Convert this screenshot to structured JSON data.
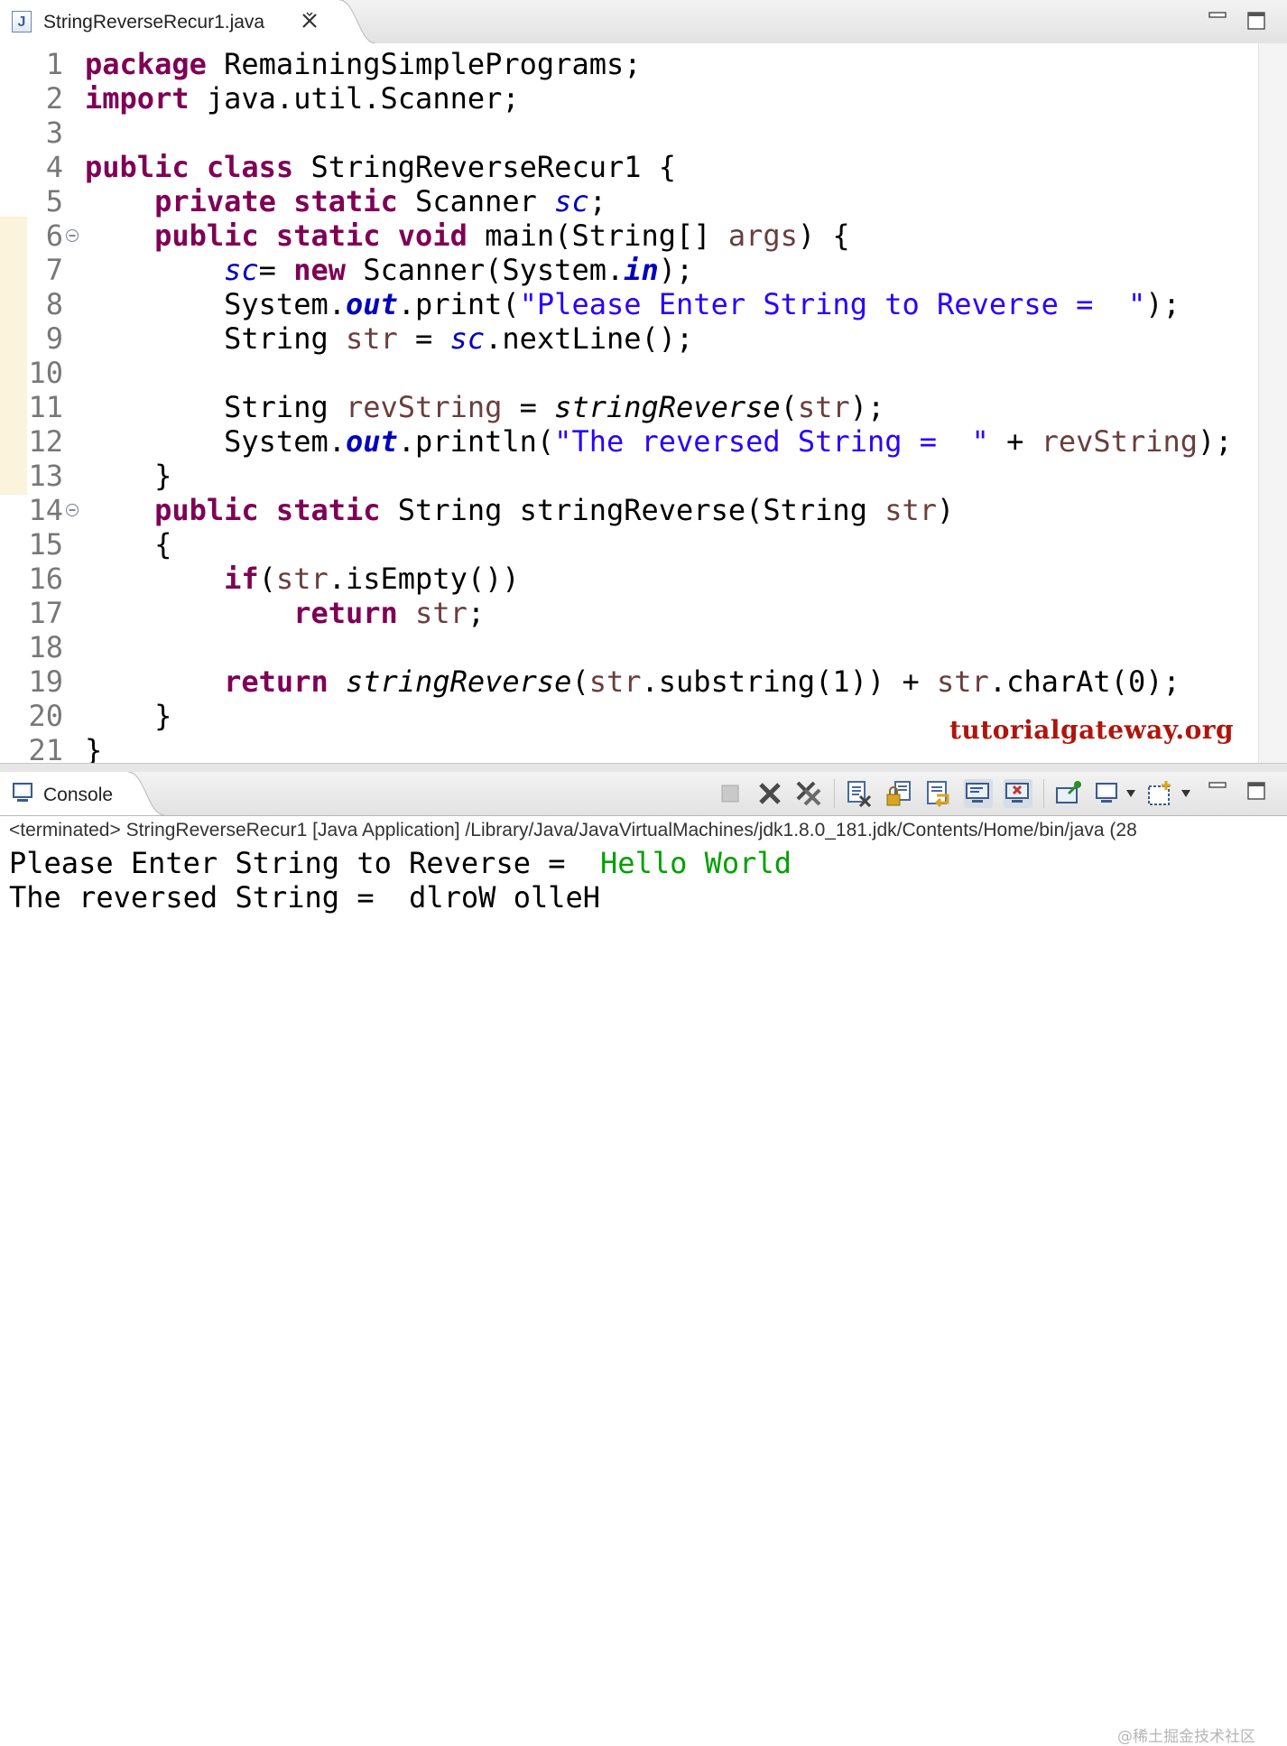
{
  "editor_tab": {
    "title": "StringReverseRecur1.java",
    "icon": "java-file-icon",
    "icon_letter": "J"
  },
  "code": {
    "line_numbers": [
      "1",
      "2",
      "3",
      "4",
      "5",
      "6",
      "7",
      "8",
      "9",
      "10",
      "11",
      "12",
      "13",
      "14",
      "15",
      "16",
      "17",
      "18",
      "19",
      "20",
      "21"
    ],
    "folded_lines": [
      "6",
      "14"
    ],
    "lines": [
      [
        {
          "t": "package",
          "k": "kw"
        },
        {
          "t": " RemainingSimplePrograms;"
        }
      ],
      [
        {
          "t": "import",
          "k": "kw"
        },
        {
          "t": " java.util.Scanner;"
        }
      ],
      [],
      [
        {
          "t": "public",
          "k": "kw"
        },
        {
          "t": " "
        },
        {
          "t": "class",
          "k": "kw"
        },
        {
          "t": " StringReverseRecur1 {"
        }
      ],
      [
        {
          "t": "    "
        },
        {
          "t": "private",
          "k": "kw"
        },
        {
          "t": " "
        },
        {
          "t": "static",
          "k": "kw"
        },
        {
          "t": " Scanner "
        },
        {
          "t": "sc",
          "k": "fld"
        },
        {
          "t": ";"
        }
      ],
      [
        {
          "t": "    "
        },
        {
          "t": "public",
          "k": "kw"
        },
        {
          "t": " "
        },
        {
          "t": "static",
          "k": "kw"
        },
        {
          "t": " "
        },
        {
          "t": "void",
          "k": "kw"
        },
        {
          "t": " main(String[] "
        },
        {
          "t": "args",
          "k": "var"
        },
        {
          "t": ") {"
        }
      ],
      [
        {
          "t": "        "
        },
        {
          "t": "sc",
          "k": "fld"
        },
        {
          "t": "= "
        },
        {
          "t": "new",
          "k": "kw"
        },
        {
          "t": " Scanner(System."
        },
        {
          "t": "in",
          "k": "sfld"
        },
        {
          "t": ");"
        }
      ],
      [
        {
          "t": "        System."
        },
        {
          "t": "out",
          "k": "sfld"
        },
        {
          "t": ".print("
        },
        {
          "t": "\"Please Enter String to Reverse =  \"",
          "k": "str"
        },
        {
          "t": ");"
        }
      ],
      [
        {
          "t": "        String "
        },
        {
          "t": "str",
          "k": "var"
        },
        {
          "t": " = "
        },
        {
          "t": "sc",
          "k": "fld"
        },
        {
          "t": ".nextLine();"
        }
      ],
      [],
      [
        {
          "t": "        String "
        },
        {
          "t": "revString",
          "k": "var"
        },
        {
          "t": " = "
        },
        {
          "t": "stringReverse",
          "k": "mi"
        },
        {
          "t": "("
        },
        {
          "t": "str",
          "k": "var"
        },
        {
          "t": ");"
        }
      ],
      [
        {
          "t": "        System."
        },
        {
          "t": "out",
          "k": "sfld"
        },
        {
          "t": ".println("
        },
        {
          "t": "\"The reversed String =  \"",
          "k": "str"
        },
        {
          "t": " + "
        },
        {
          "t": "revString",
          "k": "var"
        },
        {
          "t": ");"
        }
      ],
      [
        {
          "t": "    }"
        }
      ],
      [
        {
          "t": "    "
        },
        {
          "t": "public",
          "k": "kw"
        },
        {
          "t": " "
        },
        {
          "t": "static",
          "k": "kw"
        },
        {
          "t": " String stringReverse(String "
        },
        {
          "t": "str",
          "k": "var"
        },
        {
          "t": ")"
        }
      ],
      [
        {
          "t": "    {"
        }
      ],
      [
        {
          "t": "        "
        },
        {
          "t": "if",
          "k": "kw"
        },
        {
          "t": "("
        },
        {
          "t": "str",
          "k": "var"
        },
        {
          "t": ".isEmpty())"
        }
      ],
      [
        {
          "t": "            "
        },
        {
          "t": "return",
          "k": "kw"
        },
        {
          "t": " "
        },
        {
          "t": "str",
          "k": "var"
        },
        {
          "t": ";"
        }
      ],
      [],
      [
        {
          "t": "        "
        },
        {
          "t": "return",
          "k": "kw"
        },
        {
          "t": " "
        },
        {
          "t": "stringReverse",
          "k": "mi"
        },
        {
          "t": "("
        },
        {
          "t": "str",
          "k": "var"
        },
        {
          "t": ".substring(1)) + "
        },
        {
          "t": "str",
          "k": "var"
        },
        {
          "t": ".charAt(0);"
        }
      ],
      [
        {
          "t": "    }"
        }
      ],
      [
        {
          "t": "}"
        }
      ]
    ]
  },
  "watermark": "tutorialgateway.org",
  "console": {
    "tab_title": "Console",
    "status": "<terminated> StringReverseRecur1 [Java Application] /Library/Java/JavaVirtualMachines/jdk1.8.0_181.jdk/Contents/Home/bin/java  (28",
    "output": {
      "line1_prompt": "Please Enter String to Reverse =  ",
      "line1_input": "Hello World",
      "line2": "The reversed String =  dlroW olleH"
    },
    "toolbar_icons": [
      "terminate-icon",
      "remove-launch-icon",
      "remove-all-terminated-icon",
      "clear-console-icon",
      "scroll-lock-icon",
      "word-wrap-icon",
      "show-on-stdout-icon",
      "show-on-stderr-icon",
      "pin-console-icon",
      "display-console-icon",
      "open-console-icon"
    ]
  },
  "attribution": "@稀土掘金技术社区",
  "colors": {
    "keyword": "#7f0055",
    "field": "#0000c0",
    "string": "#2a00ff",
    "local_variable": "#6a3e3e",
    "user_input": "#00a000",
    "watermark": "#b0150c"
  }
}
